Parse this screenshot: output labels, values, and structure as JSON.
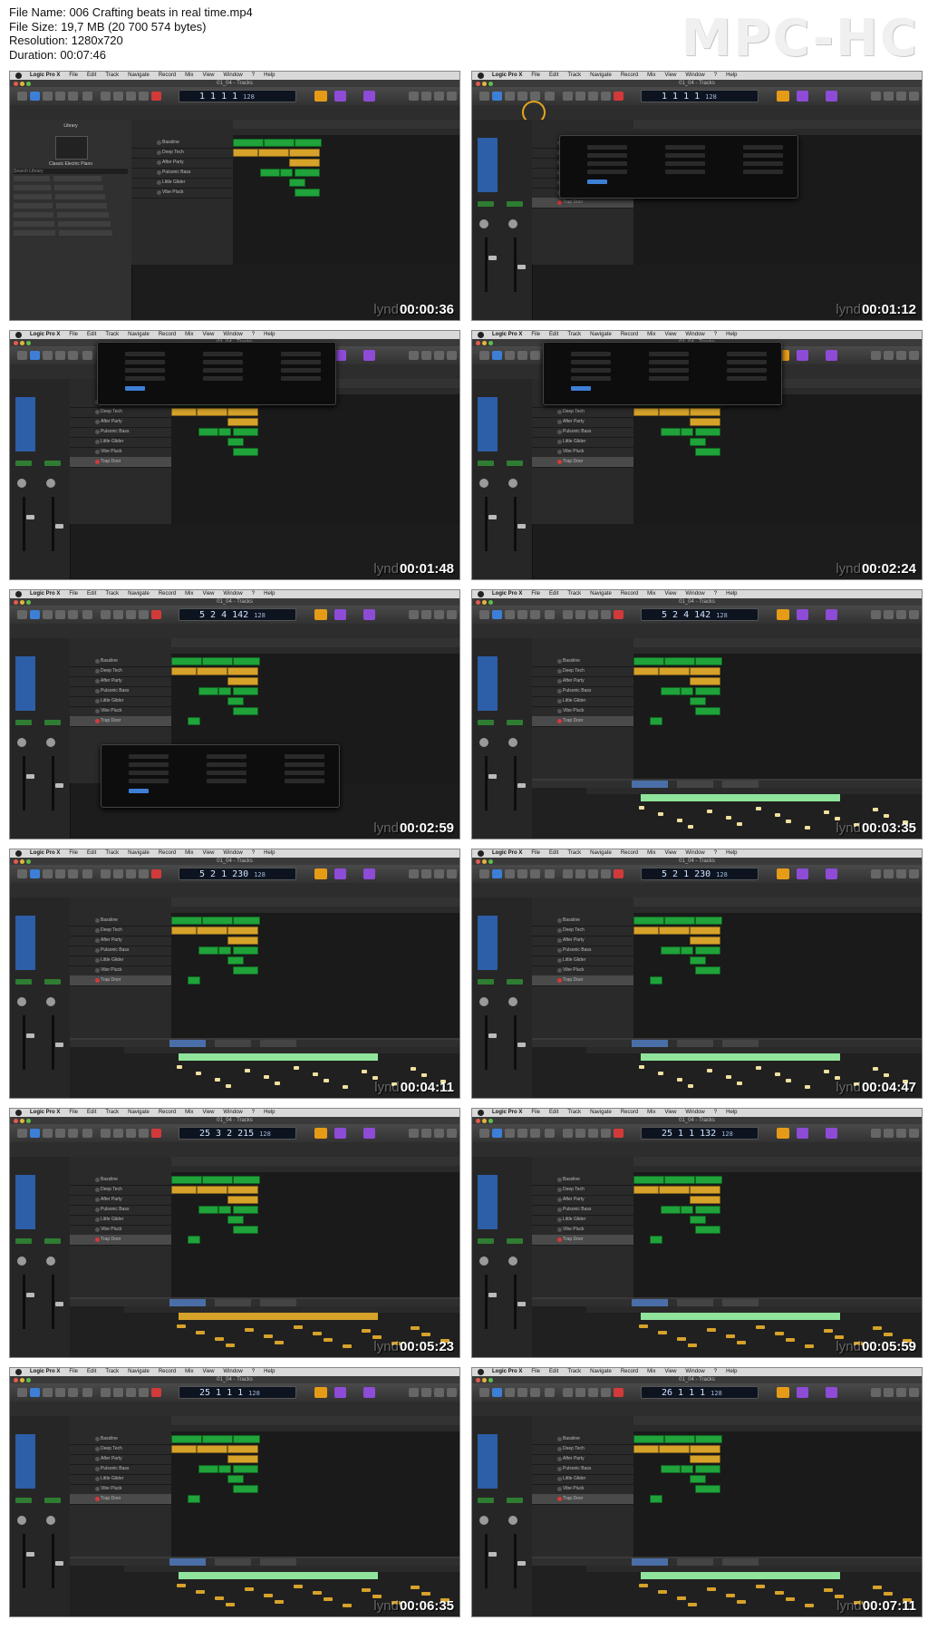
{
  "file_info": {
    "file_name": "File Name: 006 Crafting beats in real time.mp4",
    "file_size": "File Size: 19,7 MB (20 700 574 bytes)",
    "resolution": "Resolution: 1280x720",
    "duration": "Duration: 00:07:46"
  },
  "player_brand": "MPC-HC",
  "watermark": "lynd",
  "app": {
    "menu": [
      "Logic Pro X",
      "File",
      "Edit",
      "Track",
      "Navigate",
      "Record",
      "Mix",
      "View",
      "Window",
      "?",
      "Help"
    ],
    "window_title": "01_04 - Tracks"
  },
  "tracks": [
    "Bassline",
    "Deep Tech",
    "After Party",
    "Pulsonic Bass",
    "Little Glider",
    "Vibe Pluck",
    "Trap Door"
  ],
  "library": {
    "title": "Library",
    "instrument": "Classic Electric Piano",
    "search": "Search Library"
  },
  "thumbnails": [
    {
      "time": "00:00:36",
      "lcd": "1 1 1 1",
      "tempo": "128"
    },
    {
      "time": "00:01:12",
      "lcd": "1 1 1 1",
      "tempo": "128"
    },
    {
      "time": "00:01:48",
      "lcd": "1 1 1 1",
      "tempo": "128"
    },
    {
      "time": "00:02:24",
      "lcd": "1 1 1 1",
      "tempo": "128"
    },
    {
      "time": "00:02:59",
      "lcd": "5 2 4 142",
      "tempo": "128"
    },
    {
      "time": "00:03:35",
      "lcd": "5 2 4 142",
      "tempo": "128"
    },
    {
      "time": "00:04:11",
      "lcd": "5 2 1 230",
      "tempo": "128"
    },
    {
      "time": "00:04:47",
      "lcd": "5 2 1 230",
      "tempo": "128"
    },
    {
      "time": "00:05:23",
      "lcd": "25 3 2 215",
      "tempo": "128"
    },
    {
      "time": "00:05:59",
      "lcd": "25 1 1 132",
      "tempo": "128"
    },
    {
      "time": "00:06:35",
      "lcd": "25 1 1 1",
      "tempo": "128"
    },
    {
      "time": "00:07:11",
      "lcd": "26 1 1 1",
      "tempo": "128"
    }
  ],
  "colors": {
    "region_green": "#1fa33a",
    "region_yellow": "#d6a22a",
    "lcd_background": "#0d1420",
    "cycle_orange": "#e69b17",
    "tuner_purple": "#8d4bd6",
    "record_red": "#d23a3a"
  }
}
